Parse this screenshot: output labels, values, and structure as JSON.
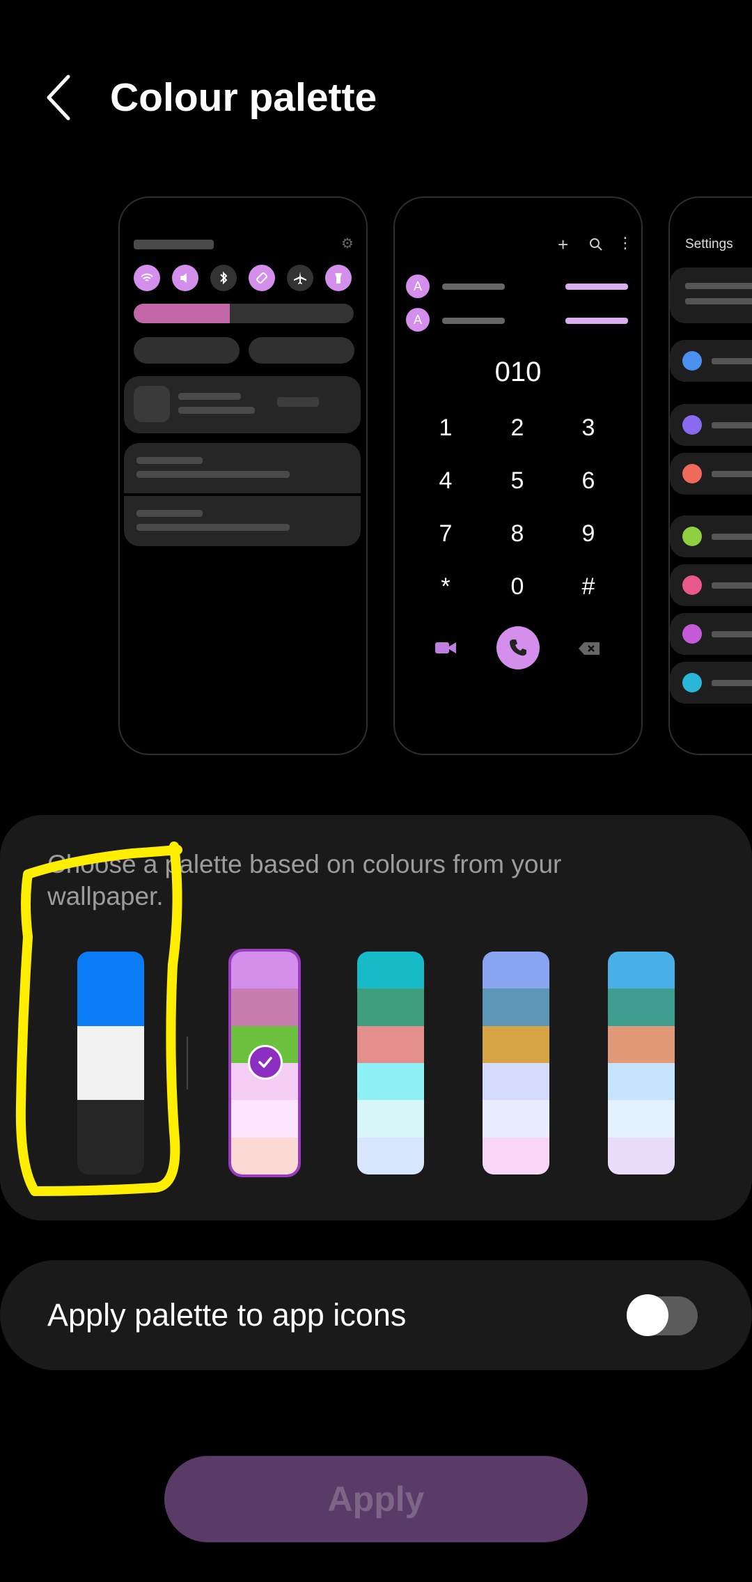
{
  "header": {
    "title": "Colour palette",
    "back_icon": "chevron-left-icon"
  },
  "previews": {
    "dialer": {
      "number": "010",
      "keys": [
        "1",
        "2",
        "3",
        "4",
        "5",
        "6",
        "7",
        "8",
        "9",
        "*",
        "0",
        "#"
      ],
      "contact_initial": "A"
    },
    "settings": {
      "title": "Settings"
    }
  },
  "palette": {
    "description": "Choose a palette based on colours from your wallpaper.",
    "selected_index": 1,
    "swatches": [
      [
        "#0a7cf5",
        "#f2f2f2",
        "#262626"
      ],
      [
        "#d48eeb",
        "#c87db0",
        "#6cc23f",
        "#f4cdf5",
        "#fde6fd",
        "#fcd9d5"
      ],
      [
        "#17bac8",
        "#3f9e7e",
        "#e3908d",
        "#8cf0f5",
        "#d8f6f9",
        "#d8e6fd"
      ],
      [
        "#8aa5f0",
        "#5d96b6",
        "#d6a443",
        "#d5dbfc",
        "#e9ecfd",
        "#fad6f6"
      ],
      [
        "#4ab0e8",
        "#3f9e8f",
        "#e09a78",
        "#c6e4fd",
        "#e3f1fd",
        "#e9dcfb"
      ]
    ]
  },
  "app_icons": {
    "label": "Apply palette to app icons",
    "enabled": false
  },
  "apply_button": {
    "label": "Apply"
  },
  "colors": {
    "accent": "#d48eeb",
    "highlight_annotation": "#ffee00"
  }
}
